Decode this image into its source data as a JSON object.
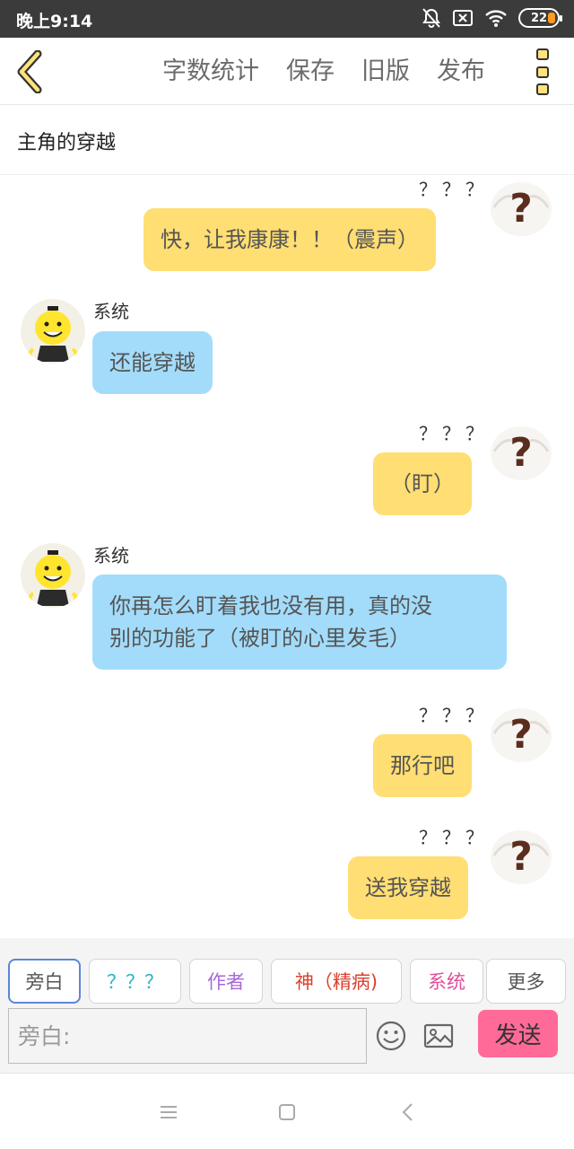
{
  "status_bar": {
    "time": "晚上9:14",
    "battery": "22",
    "icons": [
      "bell-off-icon",
      "sim-x-icon",
      "wifi-icon",
      "battery-icon"
    ]
  },
  "toolbar": {
    "back_icon": "chevron-left-icon",
    "actions": [
      "字数统计",
      "保存",
      "旧版",
      "发布"
    ],
    "more_icon": "more-vertical-icon"
  },
  "story": {
    "title": "主角的穿越"
  },
  "messages": [
    {
      "side": "right",
      "speaker": "？？？",
      "text": "快，让我康康！！（震声）",
      "color": "#ffde73",
      "avatar": "question-mark-avatar"
    },
    {
      "side": "left",
      "speaker": "系统",
      "text": "还能穿越",
      "color": "#a3dcfa",
      "avatar": "yellow-octopus-teacher-avatar"
    },
    {
      "side": "right",
      "speaker": "？？？",
      "text": "（盯）",
      "color": "#ffde73",
      "avatar": "question-mark-avatar"
    },
    {
      "side": "left",
      "speaker": "系统",
      "text": "你再怎么盯着我也没有用，真的没别的功能了（被盯的心里发毛）",
      "line1": "你再怎么盯着我也没有用，真的没",
      "line2": "别的功能了（被盯的心里发毛）",
      "color": "#a3dcfa",
      "avatar": "yellow-octopus-teacher-avatar"
    },
    {
      "side": "right",
      "speaker": "？？？",
      "text": "那行吧",
      "color": "#ffde73",
      "avatar": "question-mark-avatar"
    },
    {
      "side": "right",
      "speaker": "？？？",
      "text": "送我穿越",
      "color": "#ffde73",
      "avatar": "question-mark-avatar"
    }
  ],
  "role_tabs": [
    {
      "label": "旁白",
      "color": "#555555",
      "active": true
    },
    {
      "label": "？？？",
      "color": "#2bb5c4",
      "active": false
    },
    {
      "label": "作者",
      "color": "#a56ad8",
      "active": false
    },
    {
      "label": "神（精病)",
      "color": "#d9412e",
      "active": false
    },
    {
      "label": "系统",
      "color": "#e0509a",
      "active": false
    },
    {
      "label": "更多",
      "color": "#555555",
      "active": false
    }
  ],
  "input": {
    "placeholder": "旁白:",
    "value": "",
    "emoji_icon": "smiley-icon",
    "image_icon": "image-icon",
    "send_label": "发送"
  },
  "nav_bar": {
    "icons": [
      "menu-icon",
      "home-square-icon",
      "back-triangle-icon"
    ]
  }
}
